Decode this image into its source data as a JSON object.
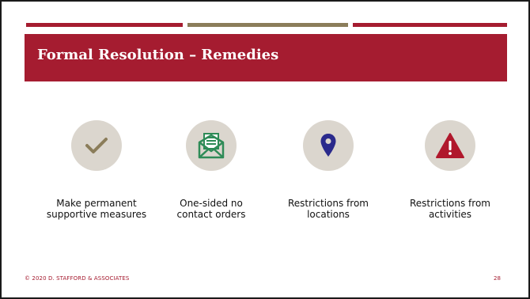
{
  "slide": {
    "title": "Formal Resolution – Remedies",
    "items": [
      {
        "icon": "checkmark-icon",
        "line1": "Make permanent",
        "line2": "supportive measures"
      },
      {
        "icon": "open-envelope-icon",
        "line1": "One-sided no",
        "line2": "contact orders"
      },
      {
        "icon": "map-pin-icon",
        "line1": "Restrictions from",
        "line2": "locations"
      },
      {
        "icon": "warning-icon",
        "line1": "Restrictions from",
        "line2": "activities"
      }
    ],
    "footer": "© 2020 D. STAFFORD & ASSOCIATES",
    "page_number": "28"
  },
  "colors": {
    "accent": "#a51c30",
    "divider_mid": "#8b7d5a",
    "icon_circle": "#dbd6ce",
    "check": "#8b7d5a",
    "envelope": "#2e8b57",
    "pin": "#2a2a8c",
    "warning": "#b0182c"
  }
}
